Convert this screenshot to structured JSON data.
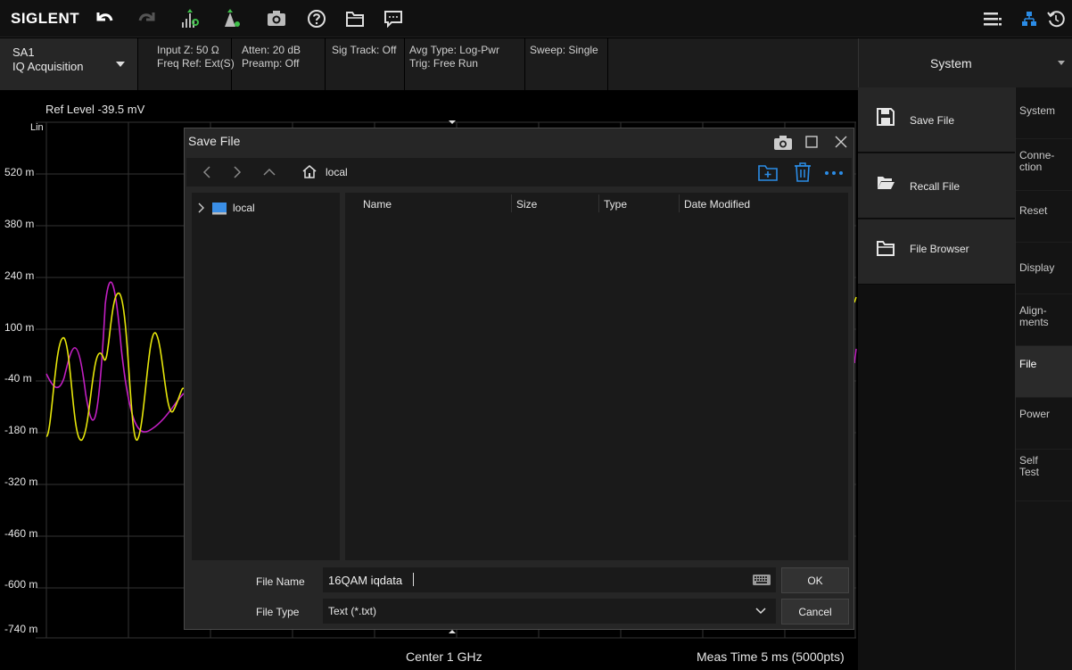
{
  "app": {
    "brand": "SIGLENT"
  },
  "toolbar": {
    "icons": [
      "undo-icon",
      "redo-icon",
      "peak-search-icon",
      "marker-icon",
      "screenshot-icon",
      "help-icon",
      "folder-icon",
      "message-icon",
      "menu-list-icon",
      "network-icon",
      "refresh-icon"
    ]
  },
  "infobar": {
    "sa": {
      "line1": "SA1",
      "line2": "IQ Acquisition"
    },
    "input": {
      "line1": "Input Z: 50 Ω",
      "line2": "Freq Ref: Ext(S)"
    },
    "atten": {
      "line1": "Atten: 20 dB",
      "line2": "Preamp: Off"
    },
    "sigtrack": {
      "line1": "Sig Track: Off"
    },
    "avg": {
      "line1": "Avg Type: Log-Pwr",
      "line2": "Trig: Free Run"
    },
    "sweep": {
      "line1": "Sweep: Single"
    }
  },
  "plot": {
    "ref_level": "Ref Level  -39.5 mV",
    "scale": "Lin",
    "y_labels": [
      "520 m",
      "380 m",
      "240 m",
      "100 m",
      "-40 m",
      "-180 m",
      "-320 m",
      "-460 m",
      "-600 m",
      "-740 m"
    ],
    "trace_colors": {
      "i": "#e6e60a",
      "q": "#c21fc2"
    },
    "center": "Center  1 GHz",
    "meas_time": "Meas Time  5 ms (5000pts)"
  },
  "right_panel": {
    "title": "System",
    "items": [
      {
        "label": "Save File",
        "icon": "save-icon"
      },
      {
        "label": "Recall File",
        "icon": "recall-icon"
      },
      {
        "label": "File Browser",
        "icon": "folder-icon"
      }
    ],
    "tabs": [
      {
        "label": "System"
      },
      {
        "label": "Conne-\nction"
      },
      {
        "label": "Reset"
      },
      {
        "label": "Display"
      },
      {
        "label": "Align-\nments"
      },
      {
        "label": "File"
      },
      {
        "label": "Power"
      },
      {
        "label": "Self\nTest"
      }
    ]
  },
  "dialog": {
    "title": "Save File",
    "path": "local",
    "tree": [
      {
        "label": "local"
      }
    ],
    "columns": [
      "Name",
      "Size",
      "Type",
      "Date Modified"
    ],
    "file_name_label": "File Name",
    "file_name_value": "16QAM iqdata",
    "file_type_label": "File Type",
    "file_type_value": "Text (*.txt)",
    "ok_label": "OK",
    "cancel_label": "Cancel"
  }
}
